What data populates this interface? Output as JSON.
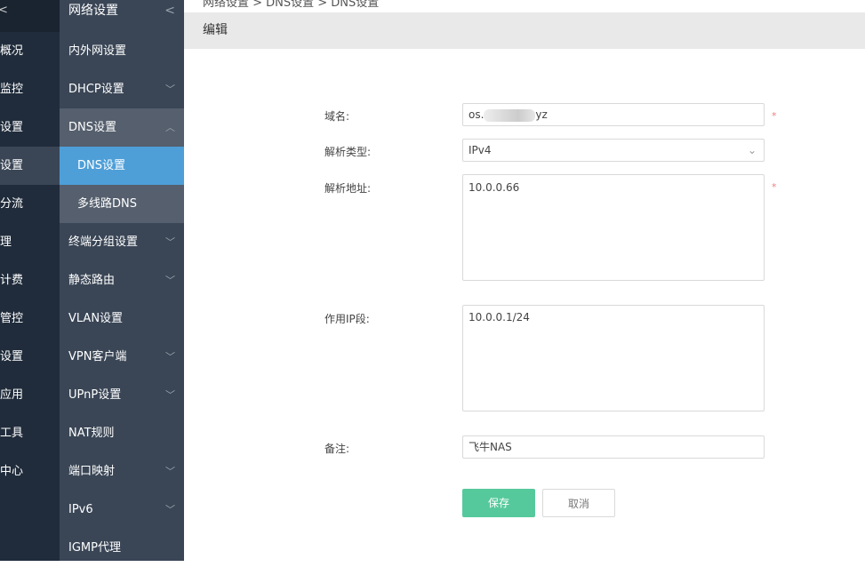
{
  "breadcrumb": "网络设置 > DNS设置 > DNS设置",
  "header": {
    "title": "编辑"
  },
  "col1": {
    "collapse": "<",
    "items": [
      "概况",
      "监控",
      "设置",
      "设置",
      "分流",
      "理",
      "计费",
      "管控",
      "设置",
      "应用",
      "工具",
      "中心"
    ]
  },
  "col2": {
    "title": "网络设置",
    "items": [
      "内外网设置",
      "DHCP设置",
      "DNS设置",
      "DNS设置",
      "多线路DNS",
      "终端分组设置",
      "静态路由",
      "VLAN设置",
      "VPN客户端",
      "UPnP设置",
      "NAT规则",
      "端口映射",
      "IPv6",
      "IGMP代理"
    ]
  },
  "form": {
    "domain_label": "域名:",
    "domain_prefix": "os.",
    "domain_suffix": "yz",
    "type_label": "解析类型:",
    "type_value": "IPv4",
    "addr_label": "解析地址:",
    "addr_value": "10.0.0.66",
    "scope_label": "作用IP段:",
    "scope_value": "10.0.0.1/24",
    "note_label": "备注:",
    "note_value": "飞牛NAS",
    "required": "*",
    "save": "保存",
    "cancel": "取消"
  },
  "colors": {
    "save": "#56c99c",
    "selected": "#4e9fd8"
  }
}
